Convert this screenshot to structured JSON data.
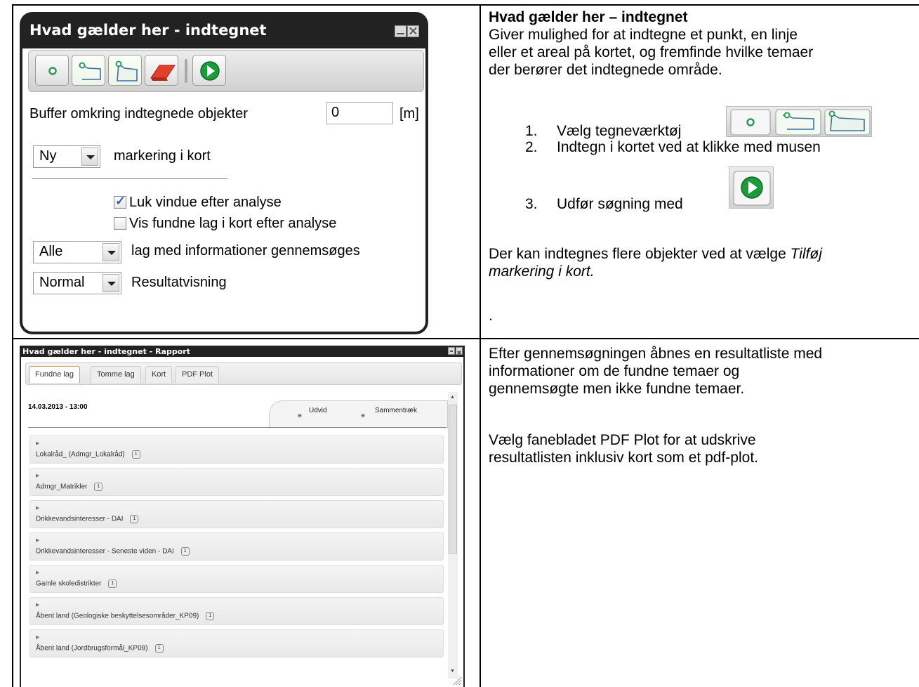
{
  "dialog_top": {
    "title": "Hvad gælder her - indtegnet",
    "buffer_label": "Buffer omkring indtegnede objekter",
    "buffer_value": "0",
    "buffer_unit": "[m]",
    "selection_mode": "Ny",
    "selection_mode_label": "markering i kort",
    "close_after_label": "Luk vindue efter analyse",
    "close_after_checked": true,
    "show_layers_label": "Vis fundne lag i kort efter analyse",
    "show_layers_checked": false,
    "layers_value": "Alle",
    "layers_label": "lag med informationer gennemsøges",
    "result_value": "Normal",
    "result_label": "Resultatvisning",
    "tools": [
      "point-tool",
      "line-tool",
      "area-tool",
      "eraser-tool",
      "run-search"
    ]
  },
  "right_top": {
    "heading": "Hvad gælder her – indtegnet",
    "intro": [
      "Giver mulighed for at indtegne et punkt, en linje",
      "eller et areal på kortet, og fremfinde hvilke temaer",
      "der berører det indtegnede område."
    ],
    "steps": [
      {
        "num": "1.",
        "text": "Vælg tegneværktøj"
      },
      {
        "num": "2.",
        "text": "Indtegn i kortet ved at klikke med musen"
      },
      {
        "num": "3.",
        "text": "Udfør søgning med"
      }
    ],
    "note_pre": "Der kan indtegnes flere objekter ved at vælge ",
    "note_italic_1": "Tilføj",
    "note_italic_2": "markering i kort.",
    "dot": "."
  },
  "dialog_bottom": {
    "title": "Hvad gælder her - indtegnet - Rapport",
    "tabs": [
      "Fundne lag",
      "Tomme lag",
      "Kort",
      "PDF Plot"
    ],
    "timestamp": "14.03.2013 - 13:00",
    "expand_label": "Udvid",
    "collapse_label": "Sammentræk",
    "rows": [
      {
        "label": "Lokalråd_ (Admgr_Lokalråd)",
        "count": "1"
      },
      {
        "label": "Admgr_Matrikler",
        "count": "1"
      },
      {
        "label": "Drikkevandsinteresser - DAI",
        "count": "1"
      },
      {
        "label": "Drikkevandsinteresser - Seneste viden - DAI",
        "count": "1"
      },
      {
        "label": "Gamle skoledistrikter",
        "count": "1"
      },
      {
        "label": "Åbent land (Geologiske beskyttelsesområder_KP09)",
        "count": "1"
      },
      {
        "label": "Åbent land (Jordbrugsformål_KP09)",
        "count": "1"
      }
    ]
  },
  "right_bottom": {
    "para1": [
      "Efter gennemsøgningen åbnes en resultatliste med",
      "informationer om de fundne temaer og",
      "gennemsøgte men ikke fundne temaer."
    ],
    "para2": [
      "Vælg fanebladet PDF Plot for at udskrive",
      "resultatlisten inklusiv kort som et pdf-plot."
    ]
  }
}
